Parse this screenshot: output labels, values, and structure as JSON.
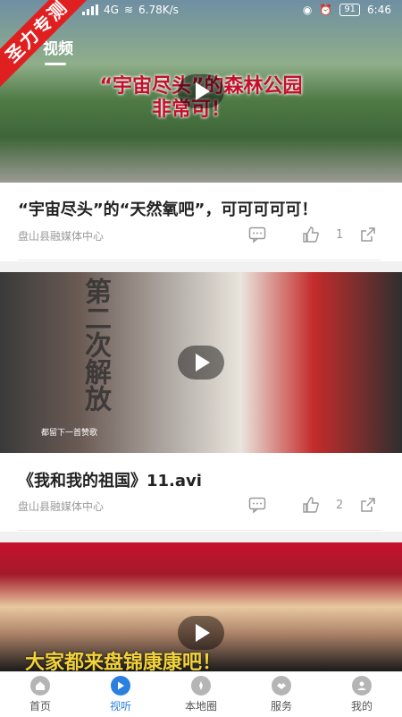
{
  "status": {
    "speed": "6.78K/s",
    "battery": "91",
    "time": "6:46",
    "signal": "4G"
  },
  "badge": {
    "text": "圣力专测"
  },
  "header": {
    "title": "视频"
  },
  "cards": [
    {
      "caption_line1": "“宇宙尽头”的森林公园",
      "caption_line2": "非常可！",
      "title": "“宇宙尽头”的“天然氧吧”，可可可可可！",
      "source": "盘山县融媒体中心",
      "likes": "1"
    },
    {
      "caption": "都留下一首赞歌",
      "wall_text": "第二次解放",
      "title": "《我和我的祖国》11.avi",
      "source": "盘山县融媒体中心",
      "likes": "2"
    },
    {
      "caption": "大家都来盘锦康康吧！"
    }
  ],
  "tabs": [
    {
      "label": "首页",
      "icon": "home-icon"
    },
    {
      "label": "视听",
      "icon": "play-icon"
    },
    {
      "label": "本地圈",
      "icon": "compass-icon"
    },
    {
      "label": "服务",
      "icon": "handshake-icon"
    },
    {
      "label": "我的",
      "icon": "user-icon"
    }
  ],
  "colors": {
    "accent": "#2b7fe0",
    "ribbon": "#e02020"
  }
}
